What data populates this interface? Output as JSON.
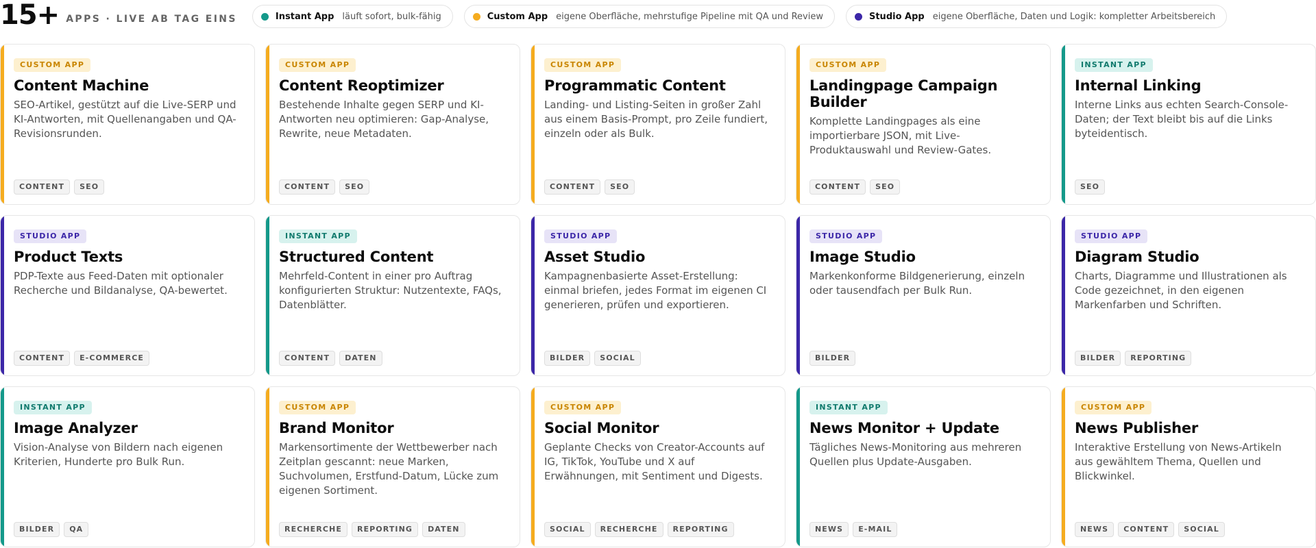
{
  "header": {
    "count": "15+",
    "subtitle": "APPS · LIVE AB TAG EINS"
  },
  "legend": [
    {
      "name": "Instant App",
      "desc": "läuft sofort, bulk-fähig",
      "color": "#14998a"
    },
    {
      "name": "Custom App",
      "desc": "eigene Oberfläche, mehrstufige Pipeline mit QA und Review",
      "color": "#f5ac1f"
    },
    {
      "name": "Studio App",
      "desc": "eigene Oberfläche, Daten und Logik: kompletter Arbeitsbereich",
      "color": "#3c27a8"
    }
  ],
  "cards": [
    {
      "badge": "CUSTOM APP",
      "title": "Content Machine",
      "desc": "SEO-Artikel, gestützt auf die Live-SERP und KI-Antworten, mit Quellenangaben und QA-Revisionsrunden.",
      "tags": [
        "CONTENT",
        "SEO"
      ]
    },
    {
      "badge": "CUSTOM APP",
      "title": "Content Reoptimizer",
      "desc": "Bestehende Inhalte gegen SERP und KI-Antworten neu optimieren: Gap-Analyse, Rewrite, neue Metadaten.",
      "tags": [
        "CONTENT",
        "SEO"
      ]
    },
    {
      "badge": "CUSTOM APP",
      "title": "Programmatic Content",
      "desc": "Landing- und Listing-Seiten in großer Zahl aus einem Basis-Prompt, pro Zeile fundiert, einzeln oder als Bulk.",
      "tags": [
        "CONTENT",
        "SEO"
      ]
    },
    {
      "badge": "CUSTOM APP",
      "title": "Landingpage Campaign Builder",
      "desc": "Komplette Landingpages als eine importierbare JSON, mit Live-Produktauswahl und Review-Gates.",
      "tags": [
        "CONTENT",
        "SEO"
      ]
    },
    {
      "badge": "INSTANT APP",
      "title": "Internal Linking",
      "desc": "Interne Links aus echten Search-Console-Daten; der Text bleibt bis auf die Links byteidentisch.",
      "tags": [
        "SEO"
      ]
    },
    {
      "badge": "STUDIO APP",
      "title": "Product Texts",
      "desc": "PDP-Texte aus Feed-Daten mit optionaler Recherche und Bildanalyse, QA-bewertet.",
      "tags": [
        "CONTENT",
        "E-COMMERCE"
      ]
    },
    {
      "badge": "INSTANT APP",
      "title": "Structured Content",
      "desc": "Mehrfeld-Content in einer pro Auftrag konfigurierten Struktur: Nutzentexte, FAQs, Datenblätter.",
      "tags": [
        "CONTENT",
        "DATEN"
      ]
    },
    {
      "badge": "STUDIO APP",
      "title": "Asset Studio",
      "desc": "Kampagnenbasierte Asset-Erstellung: einmal briefen, jedes Format im eigenen CI generieren, prüfen und exportieren.",
      "tags": [
        "BILDER",
        "SOCIAL"
      ]
    },
    {
      "badge": "STUDIO APP",
      "title": "Image Studio",
      "desc": "Markenkonforme Bildgenerierung, einzeln oder tausendfach per Bulk Run.",
      "tags": [
        "BILDER"
      ]
    },
    {
      "badge": "STUDIO APP",
      "title": "Diagram Studio",
      "desc": "Charts, Diagramme und Illustrationen als Code gezeichnet, in den eigenen Markenfarben und Schriften.",
      "tags": [
        "BILDER",
        "REPORTING"
      ]
    },
    {
      "badge": "INSTANT APP",
      "title": "Image Analyzer",
      "desc": "Vision-Analyse von Bildern nach eigenen Kriterien, Hunderte pro Bulk Run.",
      "tags": [
        "BILDER",
        "QA"
      ]
    },
    {
      "badge": "CUSTOM APP",
      "title": "Brand Monitor",
      "desc": "Markensortimente der Wettbewerber nach Zeitplan gescannt: neue Marken, Suchvolumen, Erstfund-Datum, Lücke zum eigenen Sortiment.",
      "tags": [
        "RECHERCHE",
        "REPORTING",
        "DATEN"
      ]
    },
    {
      "badge": "CUSTOM APP",
      "title": "Social Monitor",
      "desc": "Geplante Checks von Creator-Accounts auf IG, TikTok, YouTube und X auf Erwähnungen, mit Sentiment und Digests.",
      "tags": [
        "SOCIAL",
        "RECHERCHE",
        "REPORTING"
      ]
    },
    {
      "badge": "INSTANT APP",
      "title": "News Monitor + Update",
      "desc": "Tägliches News-Monitoring aus mehreren Quellen plus Update-Ausgaben.",
      "tags": [
        "NEWS",
        "E-MAIL"
      ]
    },
    {
      "badge": "CUSTOM APP",
      "title": "News Publisher",
      "desc": "Interaktive Erstellung von News-Artikeln aus gewähltem Thema, Quellen und Blickwinkel.",
      "tags": [
        "NEWS",
        "CONTENT",
        "SOCIAL"
      ]
    }
  ]
}
